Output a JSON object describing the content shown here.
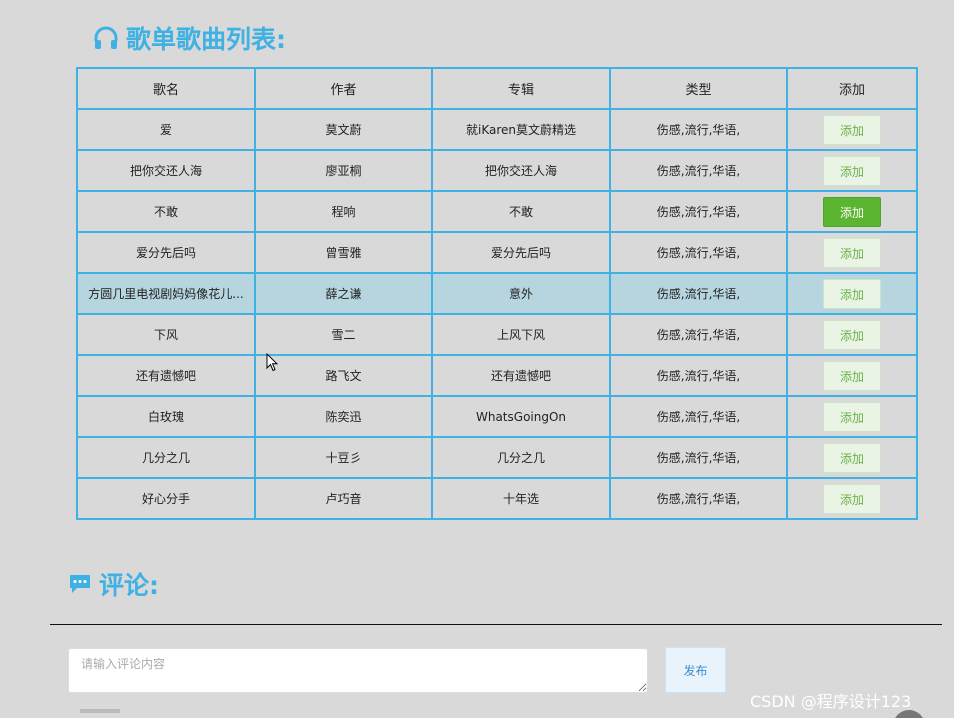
{
  "songs_section": {
    "title": "歌单歌曲列表:",
    "columns": [
      "歌名",
      "作者",
      "专辑",
      "类型",
      "添加"
    ],
    "add_label": "添加",
    "rows": [
      {
        "name": "爱",
        "artist": "莫文蔚",
        "album": "就iKaren莫文蔚精选",
        "genre": "伤感,流行,华语,"
      },
      {
        "name": "把你交还人海",
        "artist": "廖亚桐",
        "album": "把你交还人海",
        "genre": "伤感,流行,华语,"
      },
      {
        "name": "不敢",
        "artist": "程响",
        "album": "不敢",
        "genre": "伤感,流行,华语,"
      },
      {
        "name": "爱分先后吗",
        "artist": "曾雪雅",
        "album": "爱分先后吗",
        "genre": "伤感,流行,华语,"
      },
      {
        "name": "方圆几里电视剧妈妈像花儿...",
        "artist": "薛之谦",
        "album": "意外",
        "genre": "伤感,流行,华语,"
      },
      {
        "name": "下风",
        "artist": "雪二",
        "album": "上风下风",
        "genre": "伤感,流行,华语,"
      },
      {
        "name": "还有遗憾吧",
        "artist": "路飞文",
        "album": "还有遗憾吧",
        "genre": "伤感,流行,华语,"
      },
      {
        "name": "白玫瑰",
        "artist": "陈奕迅",
        "album": "WhatsGoingOn",
        "genre": "伤感,流行,华语,"
      },
      {
        "name": "几分之几",
        "artist": "十豆彡",
        "album": "几分之几",
        "genre": "伤感,流行,华语,"
      },
      {
        "name": "好心分手",
        "artist": "卢巧音",
        "album": "十年选",
        "genre": "伤感,流行,华语,"
      }
    ],
    "active_add_row": 2,
    "highlighted_row": 4
  },
  "comments_section": {
    "title": "评论:",
    "input_placeholder": "请输入评论内容",
    "publish_label": "发布"
  },
  "watermark": "CSDN @程序设计123",
  "colors": {
    "accent": "#3fb1e3",
    "add_button": "#5cb531",
    "background": "#d9d9d9"
  },
  "icons": {
    "songs_title_icon": "headphones-icon",
    "comments_title_icon": "comment-icon"
  }
}
